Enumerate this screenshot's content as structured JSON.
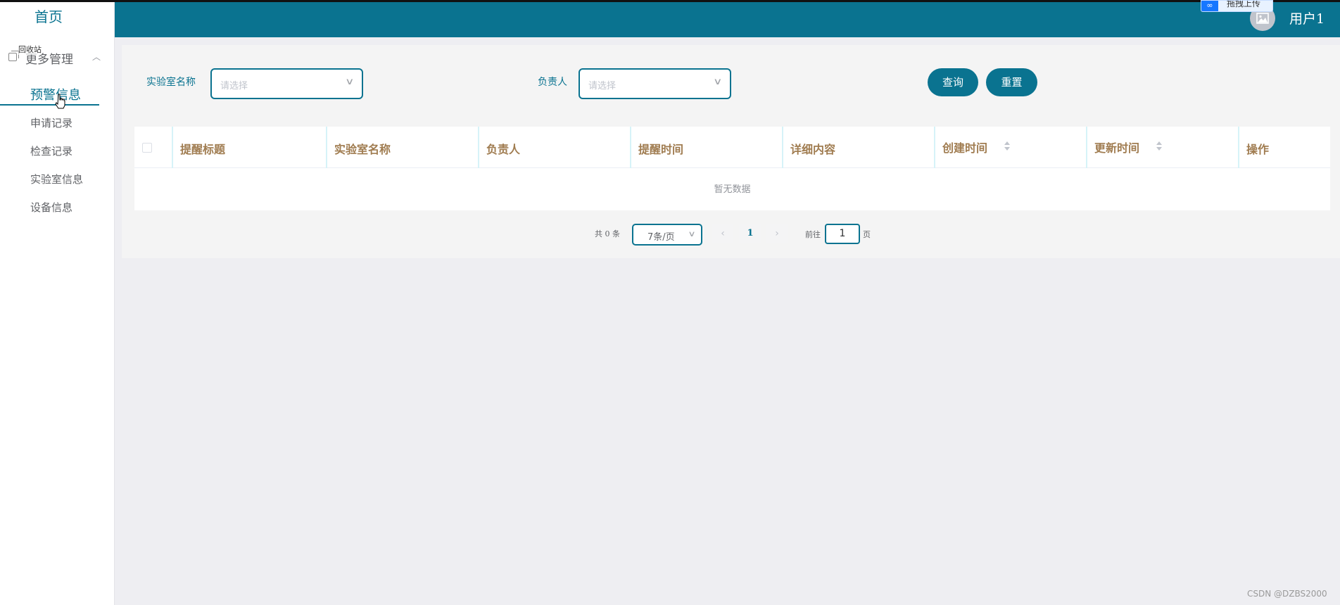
{
  "sidebar": {
    "home": "首页",
    "group": {
      "label": "更多管理",
      "overlay": "回收站"
    },
    "active_item": "预警信息",
    "items": [
      "申请记录",
      "检查记录",
      "实验室信息",
      "设备信息"
    ]
  },
  "header": {
    "user_name": "用户1",
    "upload_badge": "拖拽上传"
  },
  "search": {
    "lab_label": "实验室名称",
    "lab_placeholder": "请选择",
    "owner_label": "负责人",
    "owner_placeholder": "请选择",
    "query_button": "查询",
    "reset_button": "重置"
  },
  "table": {
    "columns": [
      "提醒标题",
      "实验室名称",
      "负责人",
      "提醒时间",
      "详细内容",
      "创建时间",
      "更新时间",
      "操作"
    ],
    "empty_text": "暂无数据"
  },
  "pagination": {
    "total_text": "共 0 条",
    "page_size": "7条/页",
    "current_page": "1",
    "goto_prefix": "前往",
    "goto_value": "1",
    "goto_suffix": "页"
  },
  "footer": {
    "watermark": "CSDN @DZBS2000"
  },
  "colors": {
    "primary": "#0a7390",
    "header_text": "#a07c50",
    "background": "#eeeef2"
  }
}
